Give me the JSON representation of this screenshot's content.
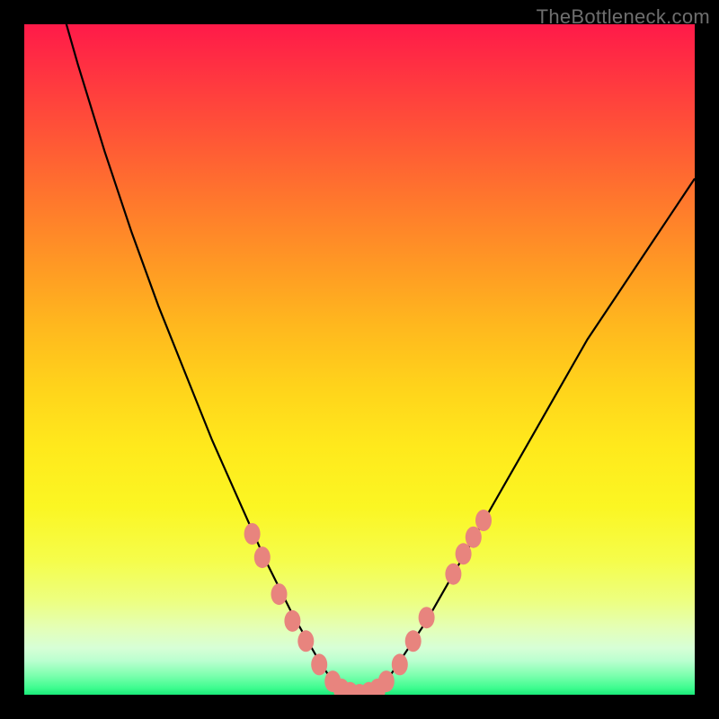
{
  "watermark": {
    "text": "TheBottleneck.com"
  },
  "gradient": {
    "top": "#ff1a49",
    "mid_upper": "#ff9924",
    "mid": "#ffe91c",
    "mid_lower": "#f5fd4b",
    "bottom": "#1ae979"
  },
  "chart_data": {
    "type": "line",
    "title": "",
    "xlabel": "",
    "ylabel": "",
    "xlim": [
      0,
      100
    ],
    "ylim": [
      0,
      100
    ],
    "x": [
      0,
      4,
      8,
      12,
      16,
      20,
      24,
      28,
      32,
      36,
      40,
      44,
      46,
      48,
      50,
      52,
      54,
      56,
      60,
      64,
      68,
      72,
      76,
      80,
      84,
      88,
      92,
      96,
      100
    ],
    "series": [
      {
        "name": "bottleneck-curve",
        "values": [
          124,
          108,
          94,
          81,
          69,
          58,
          48,
          38,
          29,
          20,
          12,
          5,
          2,
          0.5,
          0,
          0.5,
          2,
          5,
          11,
          18,
          25,
          32,
          39,
          46,
          53,
          59,
          65,
          71,
          77
        ]
      }
    ],
    "markers": {
      "left_branch": [
        {
          "x": 34,
          "y": 24
        },
        {
          "x": 35.5,
          "y": 20.5
        },
        {
          "x": 38,
          "y": 15
        },
        {
          "x": 40,
          "y": 11
        },
        {
          "x": 42,
          "y": 8
        },
        {
          "x": 44,
          "y": 4.5
        }
      ],
      "bottom": [
        {
          "x": 46,
          "y": 2
        },
        {
          "x": 47.3,
          "y": 0.8
        },
        {
          "x": 48.6,
          "y": 0.3
        },
        {
          "x": 50,
          "y": 0
        },
        {
          "x": 51.4,
          "y": 0.3
        },
        {
          "x": 52.7,
          "y": 0.8
        },
        {
          "x": 54,
          "y": 2
        }
      ],
      "right_branch": [
        {
          "x": 56,
          "y": 4.5
        },
        {
          "x": 58,
          "y": 8
        },
        {
          "x": 60,
          "y": 11.5
        },
        {
          "x": 64,
          "y": 18
        },
        {
          "x": 65.5,
          "y": 21
        },
        {
          "x": 67,
          "y": 23.5
        },
        {
          "x": 68.5,
          "y": 26
        }
      ]
    },
    "marker_style": {
      "fill": "#e8847e",
      "rx": 9,
      "ry": 12
    }
  }
}
